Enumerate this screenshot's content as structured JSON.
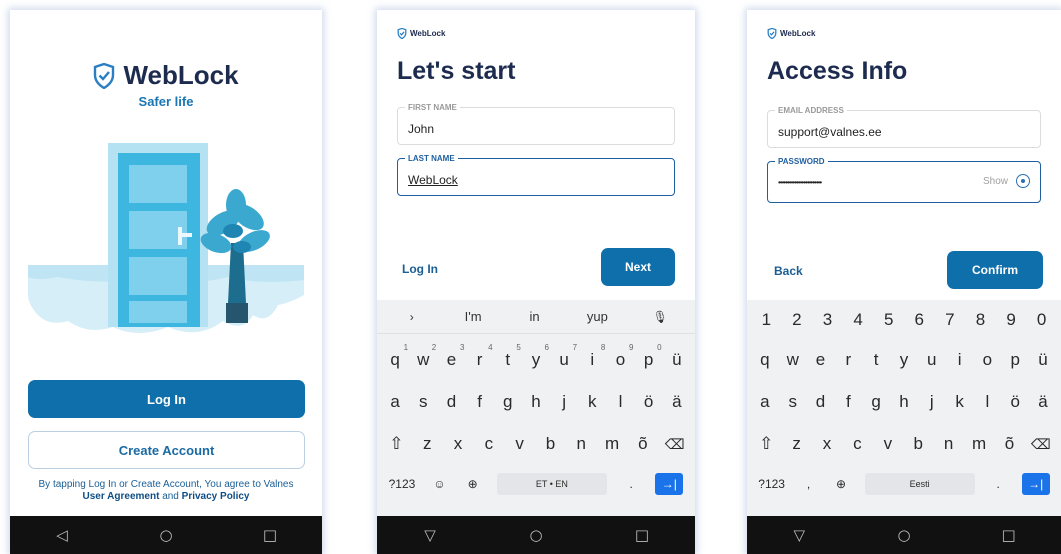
{
  "brand": {
    "name": "WebLock",
    "tagline": "Safer life"
  },
  "welcome": {
    "login_label": "Log In",
    "create_label": "Create Account",
    "terms_prefix": "By tapping Log In or Create Account, You agree to Valnes",
    "terms_ua": "User Agreement",
    "terms_and": "and",
    "terms_pp": "Privacy Policy"
  },
  "signup": {
    "title": "Let's start",
    "first_name_label": "FIRST NAME",
    "first_name_value": "John",
    "last_name_label": "LAST NAME",
    "last_name_value": "WebLock",
    "login_link": "Log In",
    "next_label": "Next",
    "keyboard": {
      "suggestions": [
        "I'm",
        "in",
        "yup"
      ],
      "row1": [
        "q",
        "w",
        "e",
        "r",
        "t",
        "y",
        "u",
        "i",
        "o",
        "p",
        "ü"
      ],
      "row1_digits": [
        "1",
        "2",
        "3",
        "4",
        "5",
        "6",
        "7",
        "8",
        "9",
        "0"
      ],
      "row2": [
        "a",
        "s",
        "d",
        "f",
        "g",
        "h",
        "j",
        "k",
        "l",
        "ö",
        "ä"
      ],
      "row3": [
        "z",
        "x",
        "c",
        "v",
        "b",
        "n",
        "m",
        "õ"
      ],
      "sym": "?123",
      "space": "ET • EN",
      "dot": "."
    }
  },
  "access": {
    "title": "Access Info",
    "email_label": "EMAIL ADDRESS",
    "email_value": "support@valnes.ee",
    "password_label": "PASSWORD",
    "password_value": "••••••••••••••••••••••••",
    "show_label": "Show",
    "back_label": "Back",
    "confirm_label": "Confirm",
    "keyboard": {
      "digits": [
        "1",
        "2",
        "3",
        "4",
        "5",
        "6",
        "7",
        "8",
        "9",
        "0"
      ],
      "row1": [
        "q",
        "w",
        "e",
        "r",
        "t",
        "y",
        "u",
        "i",
        "o",
        "p",
        "ü"
      ],
      "row2": [
        "a",
        "s",
        "d",
        "f",
        "g",
        "h",
        "j",
        "k",
        "l",
        "ö",
        "ä"
      ],
      "row3": [
        "z",
        "x",
        "c",
        "v",
        "b",
        "n",
        "m",
        "õ"
      ],
      "sym": "?123",
      "comma": ",",
      "space": "Eesti",
      "dot": "."
    }
  },
  "colors": {
    "primary": "#0f6fab",
    "brand_text": "#1d2b4f",
    "link": "#1a5e95",
    "keyboard_bg": "#f0f1f3",
    "enter_key": "#1a73e8"
  }
}
